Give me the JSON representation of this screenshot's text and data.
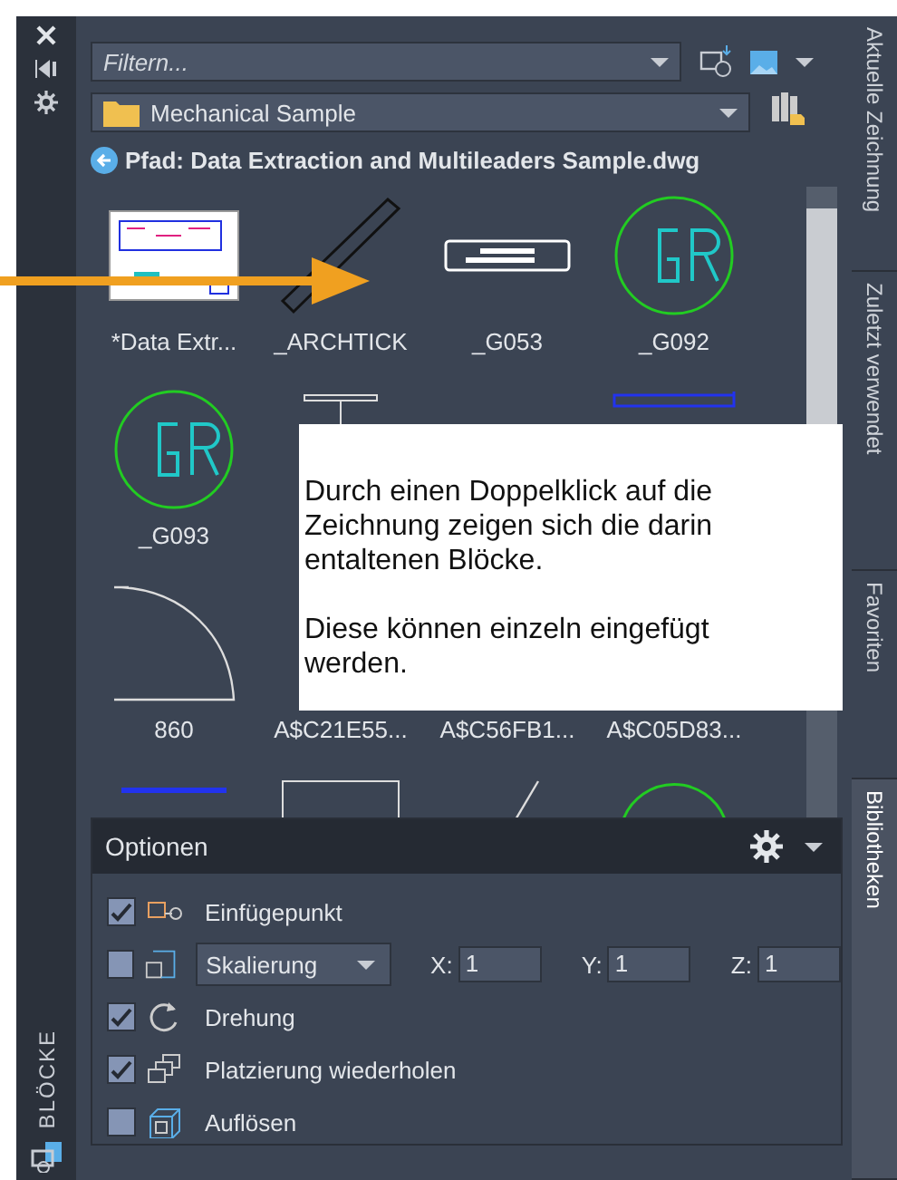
{
  "side_strip": {
    "title": "BLÖCKE"
  },
  "filter": {
    "placeholder": "Filtern..."
  },
  "library": {
    "value": "Mechanical Sample"
  },
  "path": {
    "text": "Pfad: Data Extraction and Multileaders Sample.dwg"
  },
  "blocks": [
    {
      "kind": "sheet",
      "label": "*Data Extr..."
    },
    {
      "kind": "tick",
      "label": "_ARCHTICK"
    },
    {
      "kind": "plate",
      "label": "_G053"
    },
    {
      "kind": "circle",
      "label": "_G092"
    },
    {
      "kind": "circle",
      "label": "_G093"
    },
    {
      "kind": "beam"
    },
    {
      "kind": "blank"
    },
    {
      "kind": "blueline"
    },
    {
      "kind": "arc",
      "label": "860"
    },
    {
      "kind": "blank",
      "label": "A$C21E55..."
    },
    {
      "kind": "blank",
      "label": "A$C56FB1..."
    },
    {
      "kind": "blank",
      "label": "A$C05D83..."
    },
    {
      "kind": "bluedots"
    },
    {
      "kind": "frame"
    },
    {
      "kind": "slash"
    },
    {
      "kind": "circletext"
    }
  ],
  "tooltip": {
    "paragraphs": [
      "Durch einen Doppelklick auf die Zeichnung zeigen sich die darin entaltenen Blöcke.",
      "Diese können einzeln eingefügt werden."
    ]
  },
  "options": {
    "title": "Optionen",
    "rows": [
      {
        "kind": "check",
        "checked": true,
        "label": "Einfügepunkt"
      },
      {
        "kind": "scale",
        "checked": false,
        "dropdown": "Skalierung",
        "fields": [
          {
            "label": "X:",
            "value": "1"
          },
          {
            "label": "Y:",
            "value": "1"
          },
          {
            "label": "Z:",
            "value": "1"
          }
        ]
      },
      {
        "kind": "check",
        "checked": true,
        "label": "Drehung"
      },
      {
        "kind": "check",
        "checked": true,
        "label": "Platzierung wiederholen"
      },
      {
        "kind": "check",
        "checked": false,
        "label": "Auflösen"
      }
    ]
  },
  "tabs": [
    {
      "label": "Aktuelle Zeichnung",
      "selected": false
    },
    {
      "label": "Zuletzt verwendet",
      "selected": false
    },
    {
      "label": "Favoriten",
      "selected": false
    },
    {
      "label": "Bibliotheken",
      "selected": true
    }
  ]
}
